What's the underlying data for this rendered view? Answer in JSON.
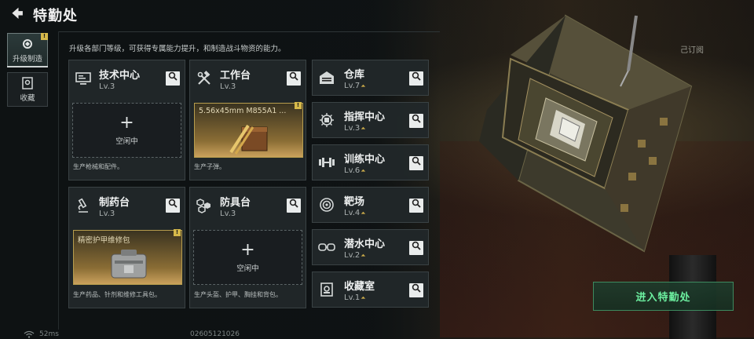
{
  "header": {
    "title": "特勤处"
  },
  "rail": [
    {
      "label": "升级制造",
      "active": true,
      "badge": "!"
    },
    {
      "label": "收藏",
      "active": false
    }
  ],
  "subtitle": "升级各部门等级，可获得专属能力提升，和制造战斗物资的能力。",
  "workshops": [
    {
      "name": "技术中心",
      "level": "Lv.3",
      "icon": "computer-icon",
      "slot_state": "空闲中",
      "desc": "生产枪械和配件。"
    },
    {
      "name": "工作台",
      "level": "Lv.3",
      "icon": "hammer-wrench-icon",
      "slot_item": "5.56x45mm M855A1 ...",
      "desc": "生产子弹。",
      "badge": "!"
    },
    {
      "name": "制药台",
      "level": "Lv.3",
      "icon": "microscope-icon",
      "slot_item": "精密护甲维修包",
      "desc": "生产药品、针剂和维修工具包。",
      "badge": "!"
    },
    {
      "name": "防具台",
      "level": "Lv.3",
      "icon": "armor-parts-icon",
      "slot_state": "空闲中",
      "desc": "生产头盔、护甲、胸挂和背包。"
    }
  ],
  "facilities": [
    {
      "name": "仓库",
      "level": "Lv.7",
      "icon": "warehouse-icon",
      "upgradable": true
    },
    {
      "name": "指挥中心",
      "level": "Lv.3",
      "icon": "command-chip-icon",
      "upgradable": true
    },
    {
      "name": "训练中心",
      "level": "Lv.6",
      "icon": "dumbbell-icon",
      "upgradable": true
    },
    {
      "name": "靶场",
      "level": "Lv.4",
      "icon": "target-icon",
      "upgradable": true
    },
    {
      "name": "潜水中心",
      "level": "Lv.2",
      "icon": "goggles-icon",
      "upgradable": true
    },
    {
      "name": "收藏室",
      "level": "Lv.1",
      "icon": "collection-icon",
      "upgradable": true
    }
  ],
  "subscribed_label": "己订阅",
  "enter_button": "进入特勤处",
  "footer": {
    "ping": "52ms",
    "uid": "02605121026"
  },
  "colors": {
    "accent_green": "#6cf0a0",
    "badge_yellow": "#d6b94a",
    "level_up": "#c9a94a"
  }
}
